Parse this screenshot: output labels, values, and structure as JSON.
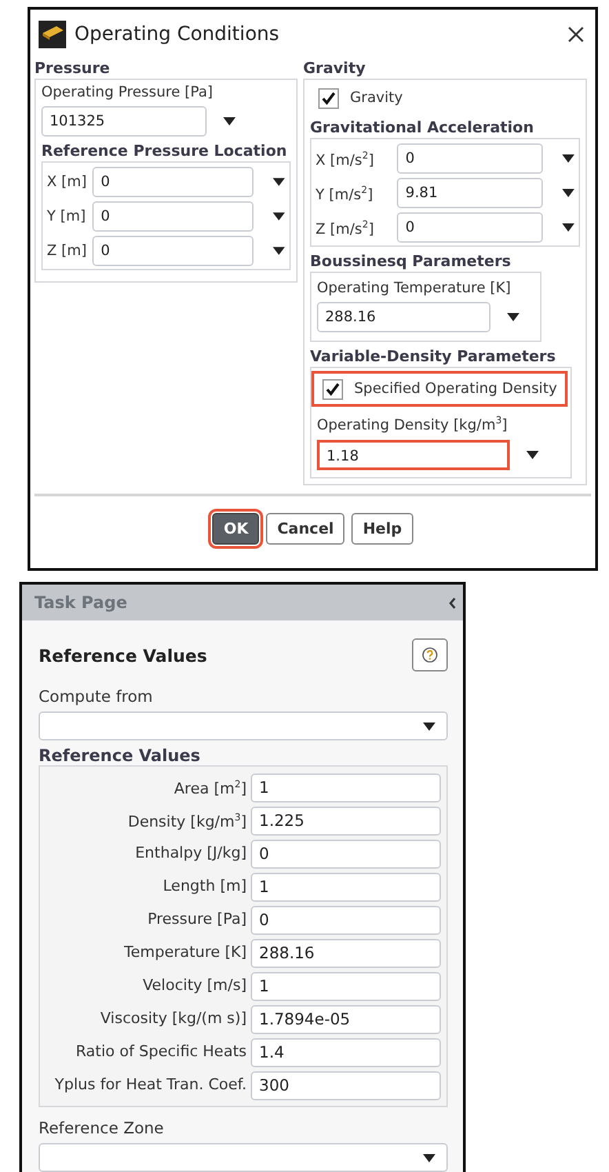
{
  "dialog": {
    "title": "Operating Conditions",
    "pressure": {
      "heading": "Pressure",
      "field": {
        "label": "Operating Pressure [Pa]",
        "value": "101325"
      },
      "location": {
        "heading": "Reference Pressure Location",
        "rows": [
          {
            "label": "X [m]",
            "value": "0"
          },
          {
            "label": "Y [m]",
            "value": "0"
          },
          {
            "label": "Z [m]",
            "value": "0"
          }
        ]
      }
    },
    "gravity": {
      "heading": "Gravity",
      "checkbox": {
        "label": "Gravity",
        "checked": true
      },
      "acceleration": {
        "heading": "Gravitational Acceleration",
        "rows": [
          {
            "label": "X [m/s$^{2}$]",
            "value": "0"
          },
          {
            "label": "Y [m/s$^{2}$]",
            "value": "9.81"
          },
          {
            "label": "Z [m/s$^{2}$]",
            "value": "0"
          }
        ]
      }
    },
    "boussinesq": {
      "heading": "Boussinesq Parameters",
      "field": {
        "label": "Operating Temperature [K]",
        "value": "288.16"
      }
    },
    "variable_density": {
      "heading": "Variable-Density Parameters",
      "checkbox": {
        "label": "Specified Operating Density",
        "checked": true,
        "highlighted": true
      },
      "field": {
        "label": "Operating Density [kg/m$^{3}$]",
        "value": "1.18",
        "highlighted": true
      }
    },
    "buttons": [
      {
        "label": "OK",
        "default": true,
        "highlighted": true
      },
      {
        "label": "Cancel",
        "default": false,
        "highlighted": false
      },
      {
        "label": "Help",
        "default": false,
        "highlighted": false
      }
    ]
  },
  "task_page": {
    "title": "Task Page",
    "heading": "Reference Values",
    "compute_from": {
      "label": "Compute from"
    },
    "reference_values": {
      "heading": "Reference Values",
      "rows": [
        {
          "label": "Area [m$^{2}$]",
          "value": "1"
        },
        {
          "label": "Density [kg/m$^{3}$]",
          "value": "1.225"
        },
        {
          "label": "Enthalpy [J/kg]",
          "value": "0"
        },
        {
          "label": "Length [m]",
          "value": "1"
        },
        {
          "label": "Pressure [Pa]",
          "value": "0"
        },
        {
          "label": "Temperature [K]",
          "value": "288.16"
        },
        {
          "label": "Velocity [m/s]",
          "value": "1"
        },
        {
          "label": "Viscosity [kg/(m s)]",
          "value": "1.7894e-05"
        },
        {
          "label": "Ratio of Specific Heats",
          "value": "1.4"
        },
        {
          "label": "Yplus for Heat Tran. Coef.",
          "value": "300"
        }
      ]
    },
    "reference_zone": {
      "label": "Reference Zone"
    }
  }
}
